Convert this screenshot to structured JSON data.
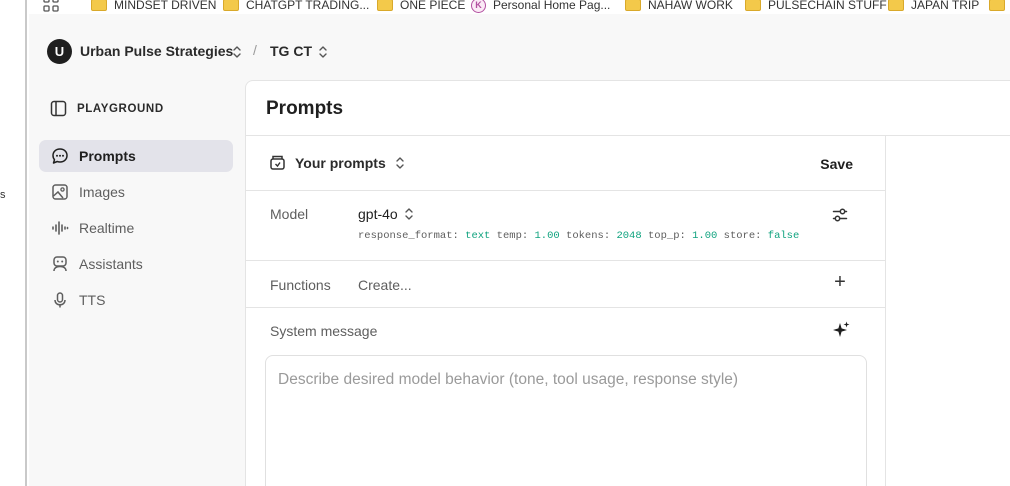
{
  "left_fragment": "s",
  "bookmarks": [
    {
      "label": "MINDSET DRIVEN",
      "icon": "folder-icon"
    },
    {
      "label": "CHATGPT TRADING...",
      "icon": "folder-icon"
    },
    {
      "label": "ONE PIECE",
      "icon": "folder-icon"
    },
    {
      "label": "Personal Home Pag...",
      "icon": "k-favicon"
    },
    {
      "label": "NAHAW WORK",
      "icon": "folder-icon"
    },
    {
      "label": "PULSECHAIN STUFF",
      "icon": "folder-icon"
    },
    {
      "label": "JAPAN TRIP",
      "icon": "folder-icon"
    }
  ],
  "header": {
    "org_avatar": "U",
    "org_name": "Urban Pulse Strategies",
    "separator": "/",
    "project_name": "TG CT"
  },
  "sidebar": {
    "title": "PLAYGROUND",
    "items": [
      {
        "label": "Prompts",
        "icon": "chat-bubble-icon",
        "active": true
      },
      {
        "label": "Images",
        "icon": "image-icon",
        "active": false
      },
      {
        "label": "Realtime",
        "icon": "waveform-icon",
        "active": false
      },
      {
        "label": "Assistants",
        "icon": "robot-icon",
        "active": false
      },
      {
        "label": "TTS",
        "icon": "microphone-icon",
        "active": false
      }
    ]
  },
  "main": {
    "title": "Prompts",
    "your_prompts_label": "Your prompts",
    "save_label": "Save",
    "model_label": "Model",
    "model_value": "gpt-4o",
    "params": {
      "response_format_key": "response_format:",
      "response_format_val": "text",
      "temp_key": "temp:",
      "temp_val": "1.00",
      "tokens_key": "tokens:",
      "tokens_val": "2048",
      "top_p_key": "top_p:",
      "top_p_val": "1.00",
      "store_key": "store:",
      "store_val": "false"
    },
    "functions_label": "Functions",
    "functions_create": "Create...",
    "system_label": "System message",
    "system_placeholder": "Describe desired model behavior (tone, tool usage, response style)"
  },
  "colors": {
    "accent_param": "#10a37f",
    "sidebar_active_bg": "#e3e3ea",
    "app_bg": "#f8f8f8"
  }
}
